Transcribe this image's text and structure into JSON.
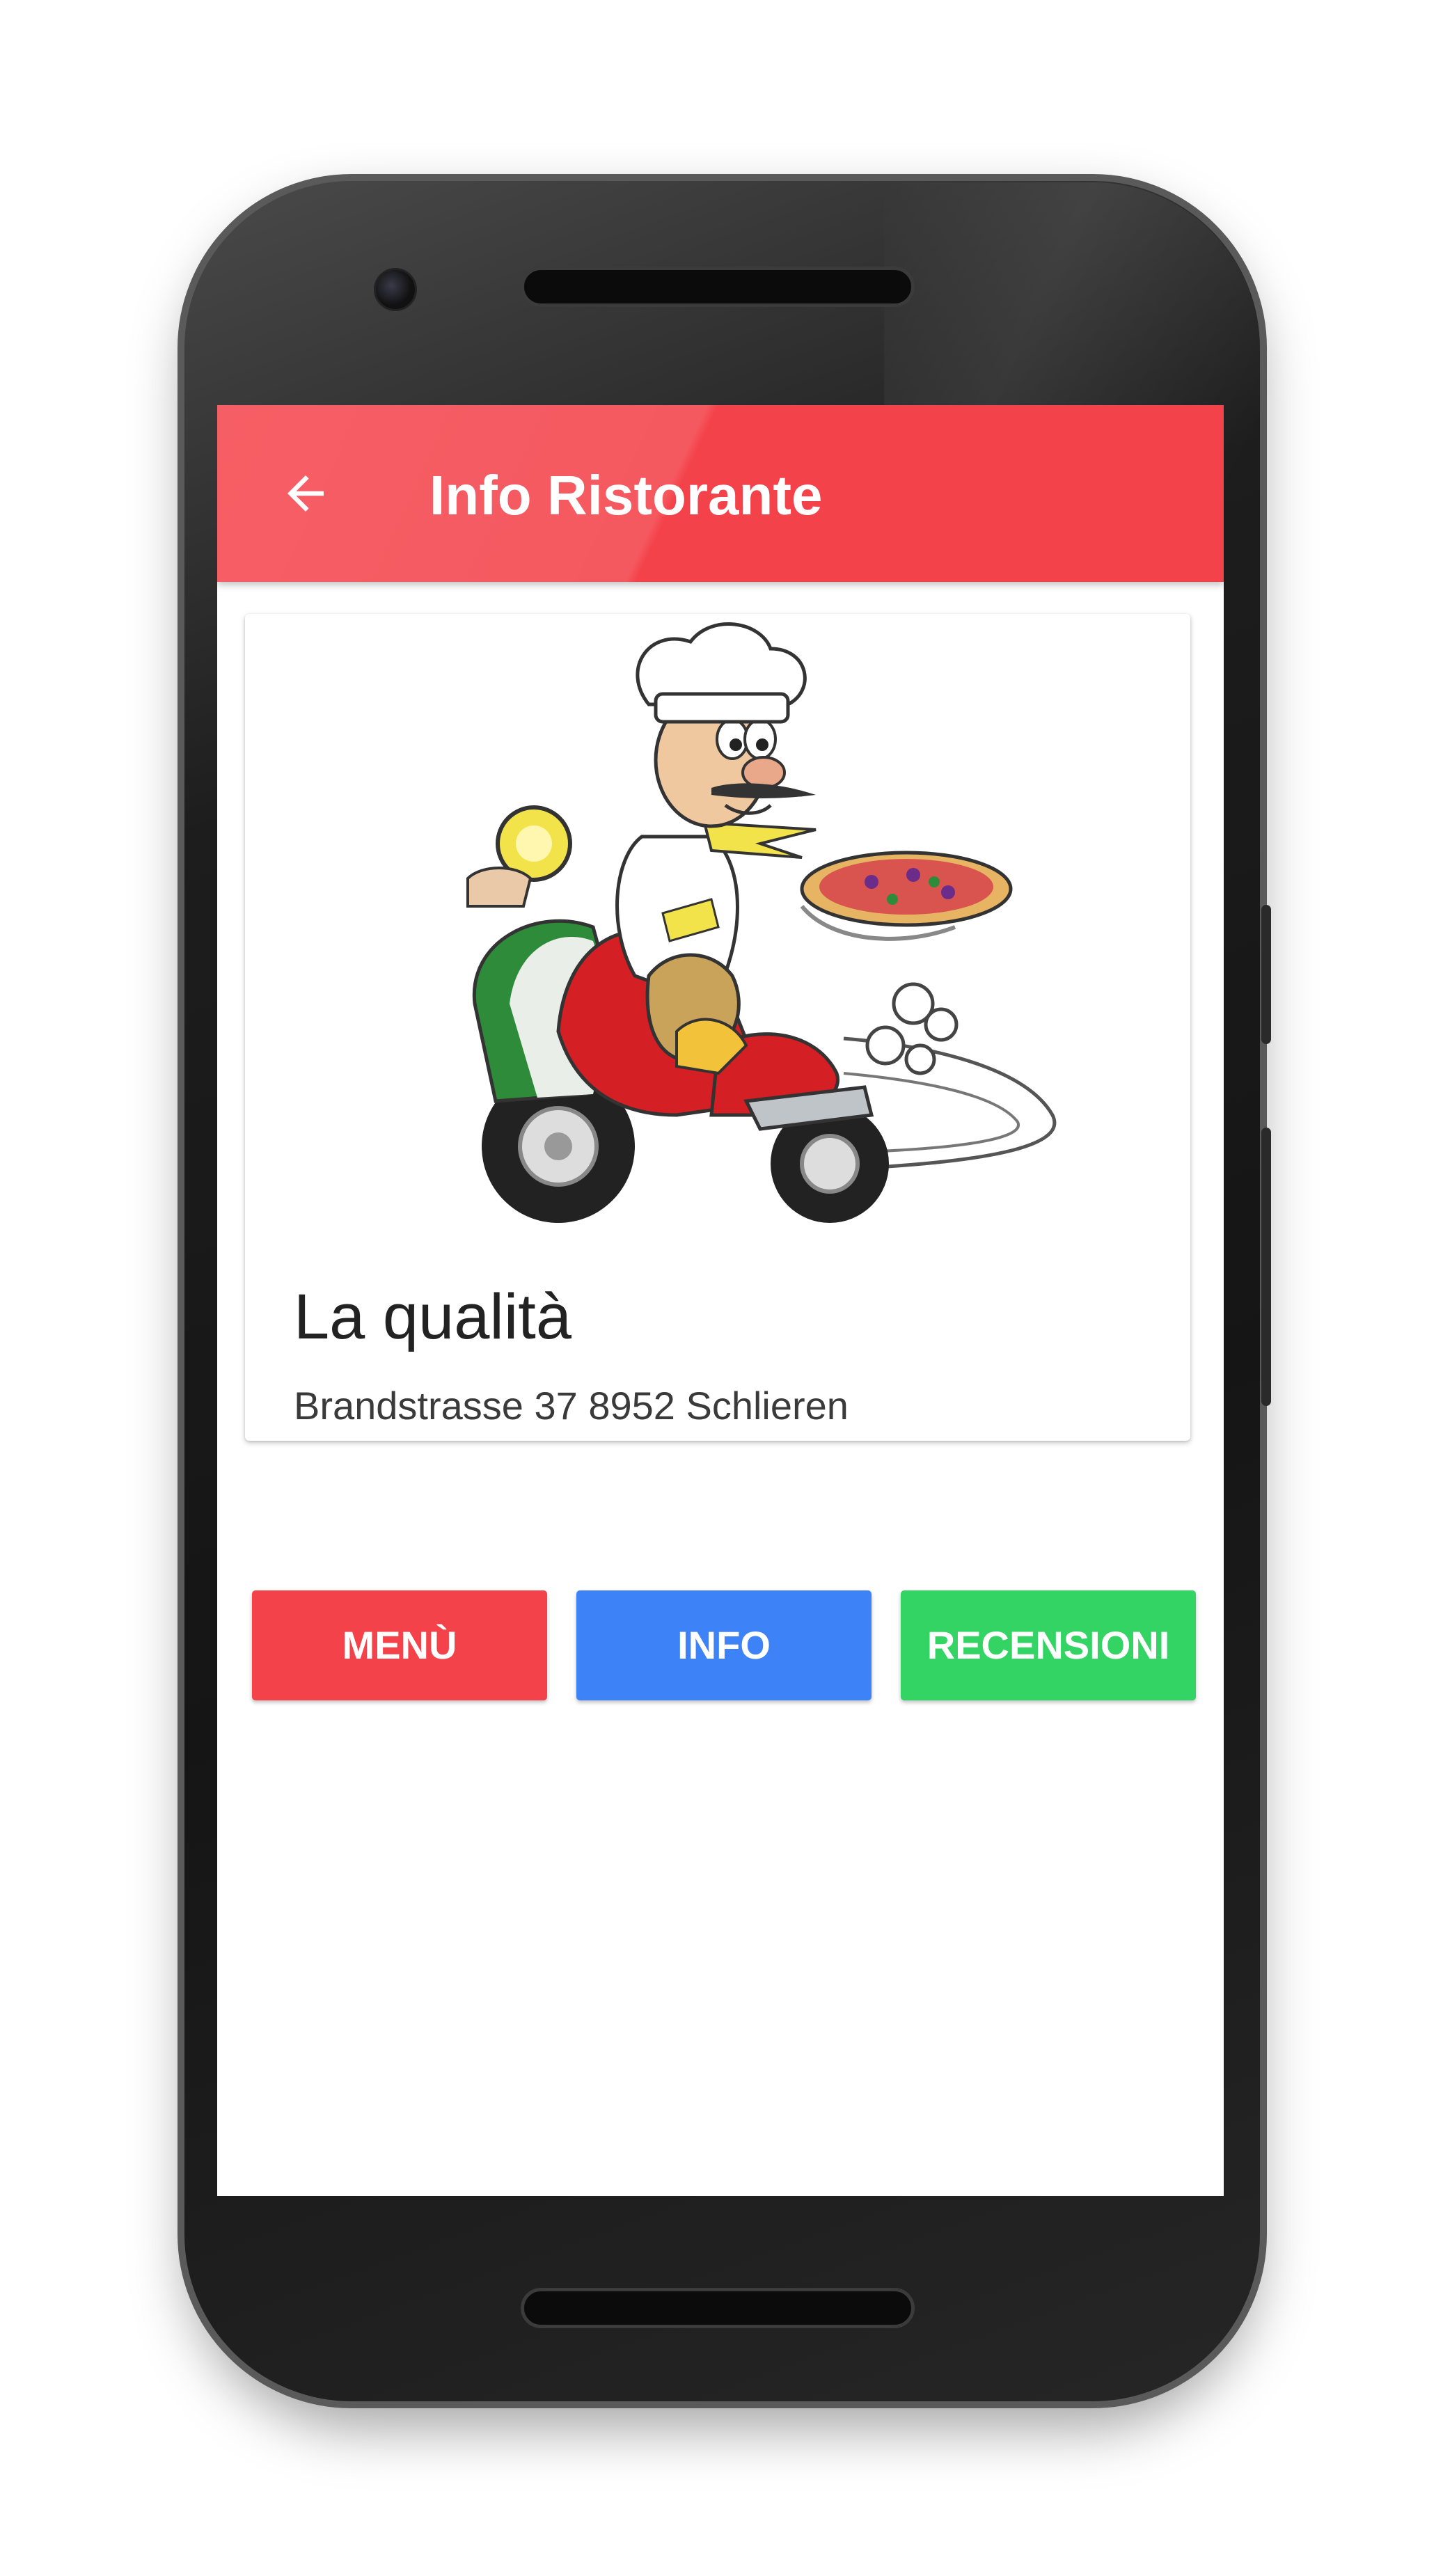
{
  "app": {
    "title": "Info Ristorante",
    "accent_color": "#f4424a"
  },
  "icons": {
    "back": "arrow-left-icon"
  },
  "restaurant": {
    "name": "La qualità",
    "address": "Brandstrasse 37 8952 Schlieren",
    "image": "chef-on-scooter-with-pizza-illustration"
  },
  "actions": {
    "menu_label": "MENÙ",
    "menu_color": "#f4424a",
    "info_label": "INFO",
    "info_color": "#3e82f7",
    "reviews_label": "RECENSIONI",
    "reviews_color": "#33d463"
  }
}
